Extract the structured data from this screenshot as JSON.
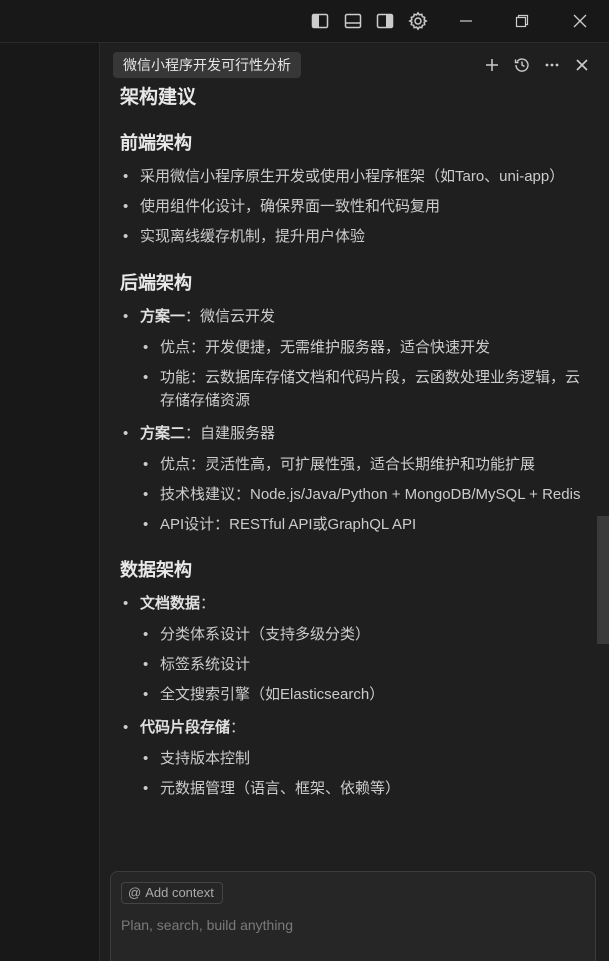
{
  "chat": {
    "tab_title": "微信小程序开发可行性分析"
  },
  "content": {
    "h_arch": "架构建议",
    "frontend": {
      "heading": "前端架构",
      "items": [
        "采用微信小程序原生开发或使用小程序框架（如Taro、uni-app）",
        "使用组件化设计，确保界面一致性和代码复用",
        "实现离线缓存机制，提升用户体验"
      ]
    },
    "backend": {
      "heading": "后端架构",
      "plan1": {
        "label": "方案一",
        "rest": "：微信云开发",
        "items": [
          "优点：开发便捷，无需维护服务器，适合快速开发",
          "功能：云数据库存储文档和代码片段，云函数处理业务逻辑，云存储存储资源"
        ]
      },
      "plan2": {
        "label": "方案二",
        "rest": "：自建服务器",
        "items": [
          "优点：灵活性高，可扩展性强，适合长期维护和功能扩展",
          "技术栈建议：Node.js/Java/Python + MongoDB/MySQL + Redis",
          "API设计：RESTful API或GraphQL API"
        ]
      }
    },
    "data": {
      "heading": "数据架构",
      "doc": {
        "label": "文档数据",
        "rest": "：",
        "items": [
          "分类体系设计（支持多级分类）",
          "标签系统设计",
          "全文搜索引擎（如Elasticsearch）"
        ]
      },
      "code": {
        "label": "代码片段存储",
        "rest": "：",
        "items": [
          "支持版本控制",
          "元数据管理（语言、框架、依赖等）"
        ]
      }
    }
  },
  "composer": {
    "add_context": "Add context",
    "placeholder": "Plan, search, build anything"
  },
  "icons": {
    "toggle_primary_sidebar": "sidebar-left-icon",
    "toggle_panel": "panel-bottom-icon",
    "toggle_secondary_sidebar": "sidebar-right-icon",
    "settings": "gear-icon",
    "minimize": "minimize-icon",
    "restore": "restore-icon",
    "close": "close-icon",
    "new_chat": "plus-icon",
    "history": "history-icon",
    "more": "more-icon",
    "close_panel": "close-icon",
    "at": "at-icon"
  }
}
